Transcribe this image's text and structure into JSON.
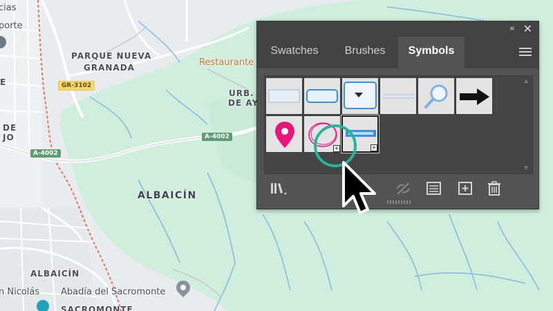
{
  "map": {
    "labels": {
      "parque_line1": "PARQUE NUEVA",
      "parque_line2": "GRANADA",
      "urb_line1": "URB.",
      "urb_line2": "DE AY",
      "albaicin_main": "ALBAICÍN",
      "albaicin_small": "ALBAICÍN",
      "sacromonte": "SACROMONTE",
      "abadia": "Abadía del Sacromonte",
      "san_nicolas": "n Nicolás",
      "restaurante": "Restaurante",
      "left_de": "DE",
      "left_jo": "JO",
      "left_e": "E",
      "top_left_1": "cias",
      "top_left_2": "porte"
    },
    "shields": {
      "gr3102": "GR-3102",
      "a4002_right": "A-4002",
      "a4002_left": "A-4002"
    }
  },
  "panel": {
    "collapse_icon": "«",
    "close_icon": "✕",
    "tabs": [
      {
        "label": "Swatches",
        "active": false
      },
      {
        "label": "Brushes",
        "active": false
      },
      {
        "label": "Symbols",
        "active": true
      }
    ],
    "symbols": [
      {
        "name": "rectangle-button-flat"
      },
      {
        "name": "rounded-button-blue"
      },
      {
        "name": "dropdown-button"
      },
      {
        "name": "divider-line"
      },
      {
        "name": "magnifier"
      },
      {
        "name": "black-arrow"
      },
      {
        "name": "map-pin"
      },
      {
        "name": "pink-circle"
      },
      {
        "name": "map-button-selected",
        "selected": true
      }
    ],
    "toolbar": [
      "symbol-libraries-menu",
      "break-link",
      "symbol-options",
      "new-symbol",
      "delete-symbol"
    ]
  },
  "colors": {
    "panel_bg": "#535353",
    "tab_bar_bg": "#424242",
    "highlight": "#25b59a",
    "map_green": "#cfeedd"
  }
}
